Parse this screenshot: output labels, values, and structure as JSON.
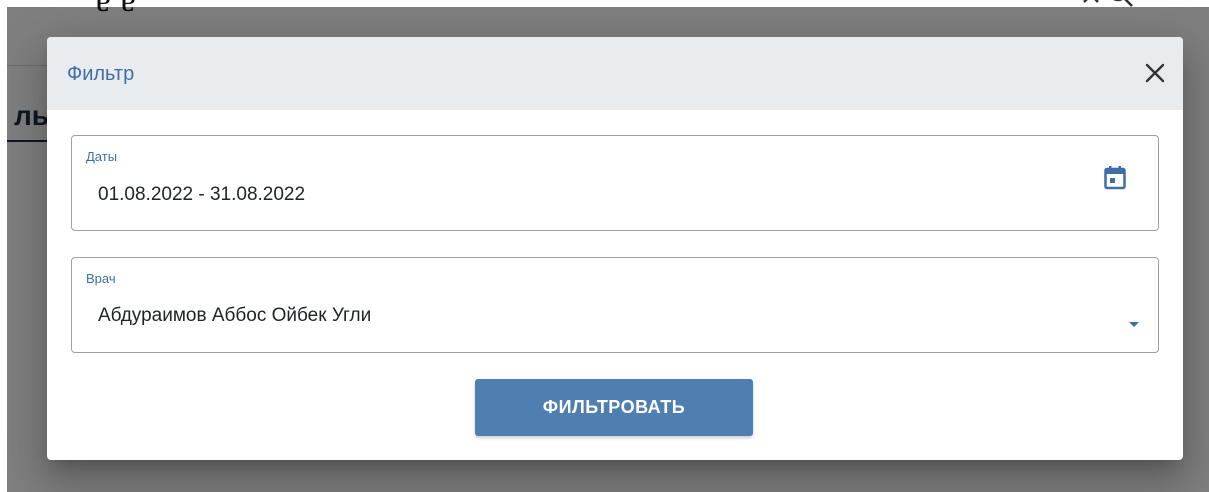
{
  "dialog": {
    "title": "Фильтр",
    "close_icon": "close-icon"
  },
  "fields": {
    "dates": {
      "label": "Даты",
      "value": "01.08.2022 - 31.08.2022",
      "icon": "calendar-icon"
    },
    "doctor": {
      "label": "Врач",
      "value": "Абдураимов Аббос Ойбек Угли",
      "icon": "chevron-down-icon"
    }
  },
  "actions": {
    "filter_label": "ФИЛЬТРОВАТЬ"
  },
  "colors": {
    "accent": "#3f6ea6",
    "button": "#4f7fb1",
    "header_bg": "#e9ecef"
  }
}
